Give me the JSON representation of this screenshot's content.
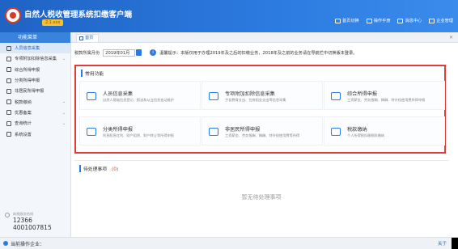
{
  "app": {
    "title": "自然人税收管理系统扣缴客户端",
    "version": "2.1.xxx"
  },
  "top_menu": [
    {
      "label": "首页切换",
      "icon": "home-switch-icon"
    },
    {
      "label": "操作手册",
      "icon": "manual-icon"
    },
    {
      "label": "消息中心",
      "icon": "message-icon"
    },
    {
      "label": "企业管理",
      "icon": "company-icon"
    }
  ],
  "sidebar": {
    "header": "功能菜单",
    "items": [
      {
        "label": "人员信息采集",
        "icon": "person-icon",
        "active": true
      },
      {
        "label": "专项附加扣除信息采集",
        "icon": "deduction-icon",
        "arrow": true
      },
      {
        "label": "综合所得申报",
        "icon": "comprehensive-icon"
      },
      {
        "label": "分类所得申报",
        "icon": "category-icon"
      },
      {
        "label": "非居民所得申报",
        "icon": "nonresident-icon"
      },
      {
        "label": "税款缴纳",
        "icon": "tax-pay-icon",
        "arrow": true
      },
      {
        "label": "优惠备案",
        "icon": "preferential-icon",
        "arrow": true
      },
      {
        "label": "查询统计",
        "icon": "query-icon",
        "arrow": true
      },
      {
        "label": "系统设置",
        "icon": "settings-icon"
      }
    ],
    "hotline_label": "纳税服务热线",
    "hotline_numbers": [
      "12366",
      "4001007815"
    ]
  },
  "tab": {
    "label": "首页"
  },
  "filter": {
    "label": "税款所属月份",
    "period": "2019年01月",
    "notice": "温馨提示：本版仅用于办理2019年及之后的扣缴业务，2018年及之前的业务请在导航栏中切换版本登录。"
  },
  "panel": {
    "title": "常用功能",
    "cards": [
      {
        "title": "人员信息采集",
        "desc": "自然人基础信息登记、报送和从业信息变动维护",
        "icon": "person-card-icon"
      },
      {
        "title": "专项附加扣除信息采集",
        "desc": "子女教育支出、住房租金支出等信息采集",
        "icon": "deduction-card-icon"
      },
      {
        "title": "综合所得申报",
        "desc": "工资薪金、劳务报酬、稿酬、特许权使用费所得申报",
        "icon": "comprehensive-card-icon"
      },
      {
        "title": "分类所得申报",
        "desc": "利息股息红利、财产租赁、财产转让等所得申报",
        "icon": "category-card-icon"
      },
      {
        "title": "非居民所得申报",
        "desc": "工资薪金、劳务报酬、稿酬、特许权使用费等所得",
        "icon": "nonresident-card-icon"
      },
      {
        "title": "税款缴纳",
        "desc": "个人所得税扣缴税款缴纳",
        "icon": "tax-pay-card-icon"
      }
    ]
  },
  "todo": {
    "title": "待处理事项",
    "count": "(0)",
    "empty": "暂无待处理事项"
  },
  "status": {
    "label": "当前操作企业：",
    "about": "关于"
  }
}
